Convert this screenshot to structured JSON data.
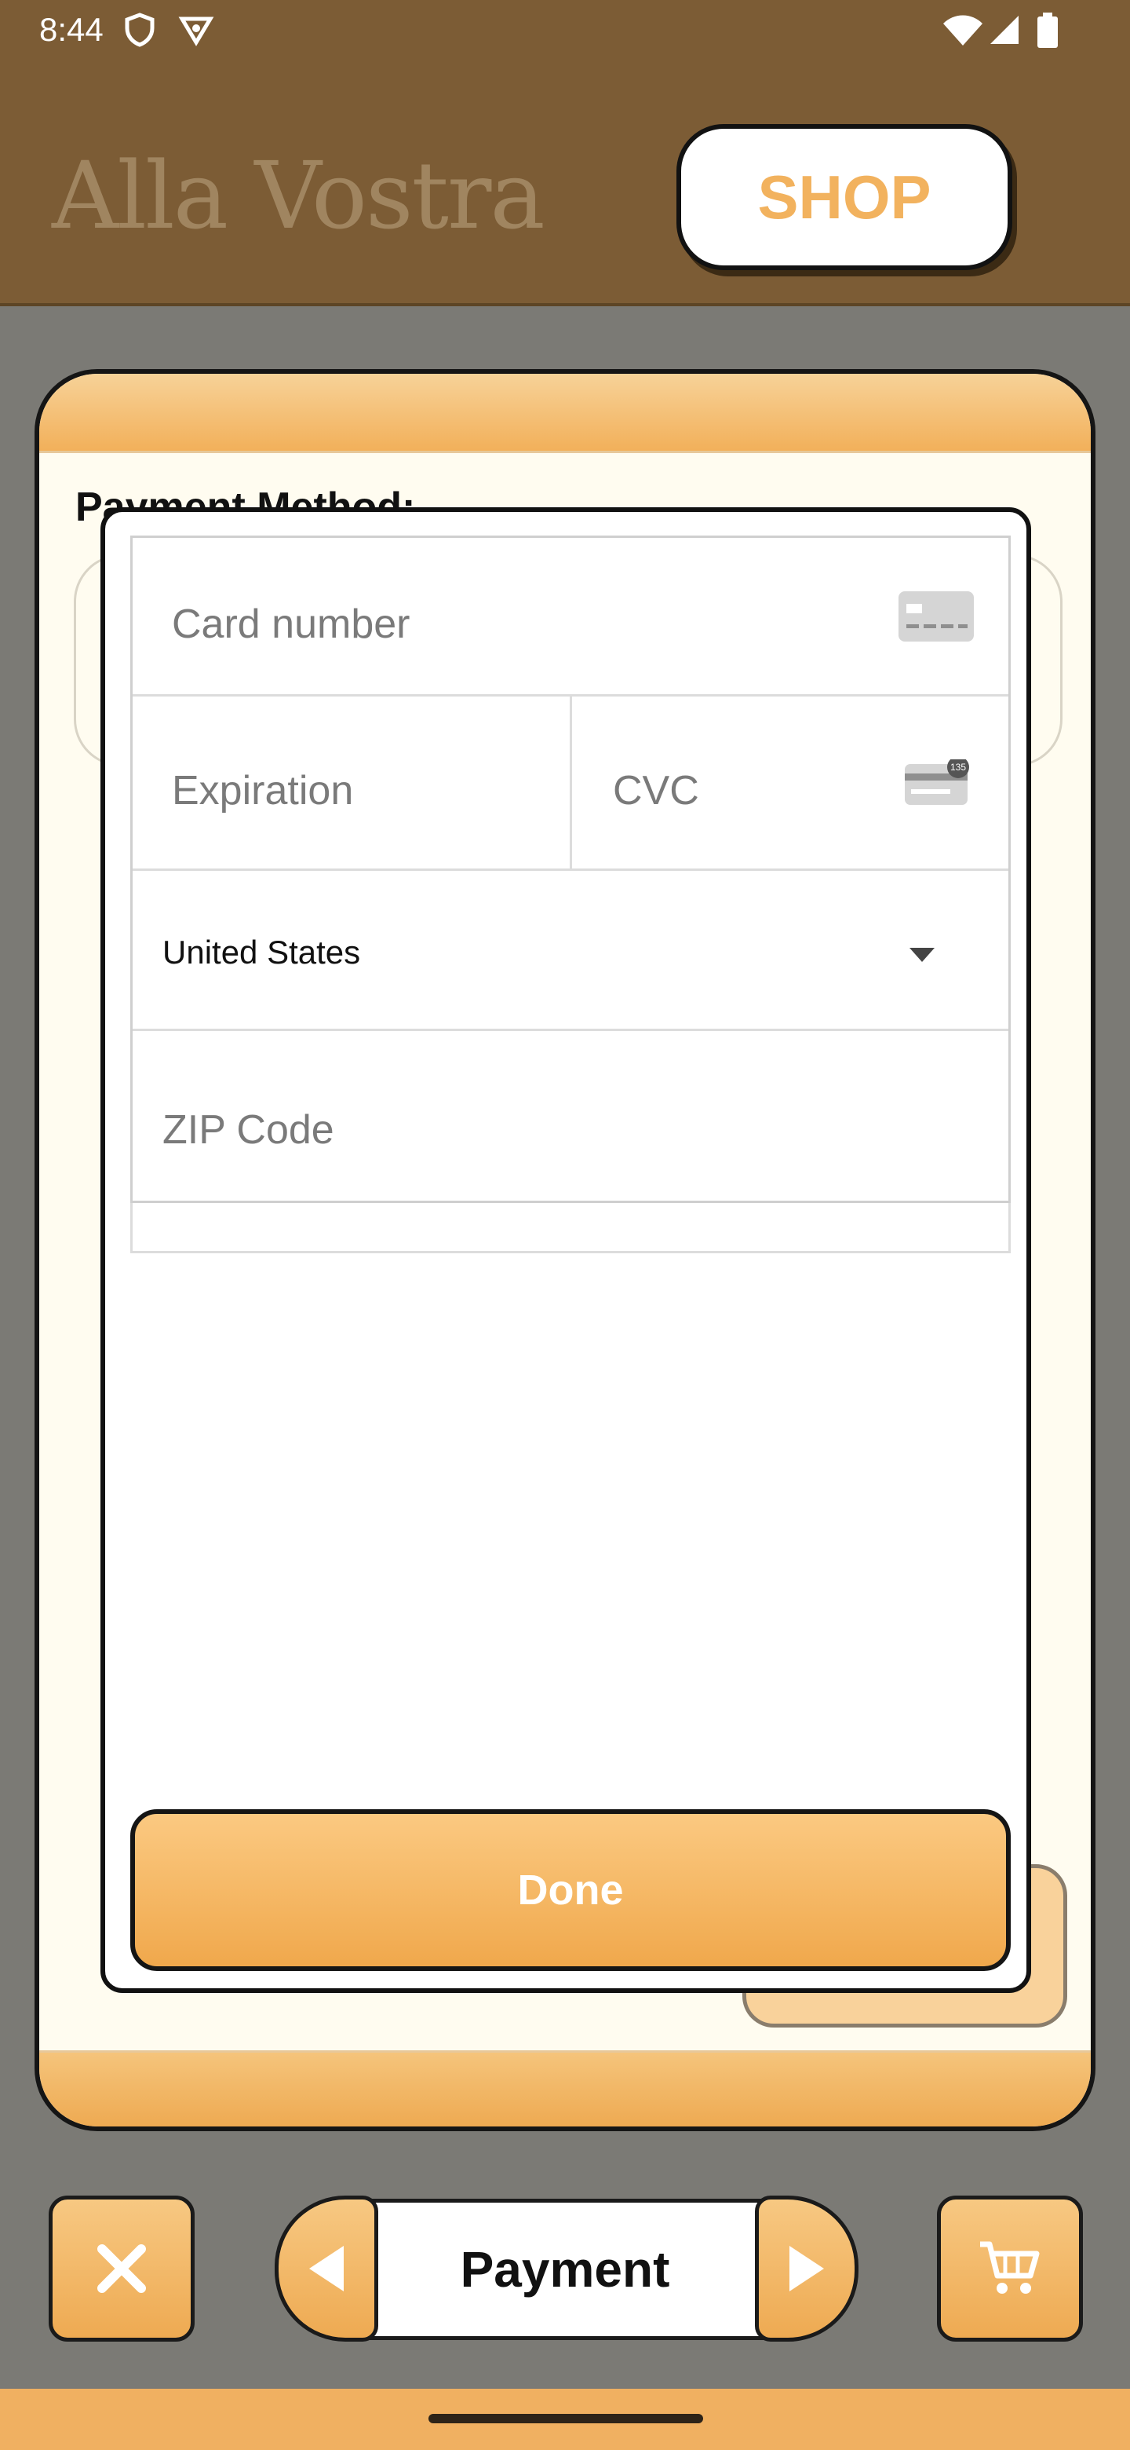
{
  "status_bar": {
    "time": "8:44"
  },
  "header": {
    "brand": "Alla Vostra",
    "shop_label": "SHOP"
  },
  "card": {
    "payment_method_label": "Payment Method:"
  },
  "payment_form": {
    "card_number_placeholder": "Card number",
    "expiration_placeholder": "Expiration",
    "cvc_placeholder": "CVC",
    "cvc_icon_digits": "135",
    "country_value": "United States",
    "zip_placeholder": "ZIP Code",
    "done_label": "Done"
  },
  "bottom_nav": {
    "step_label": "Payment"
  },
  "colors": {
    "brown": "#7c5c35",
    "orange": "#f2b05a",
    "cream": "#fffcf0"
  }
}
